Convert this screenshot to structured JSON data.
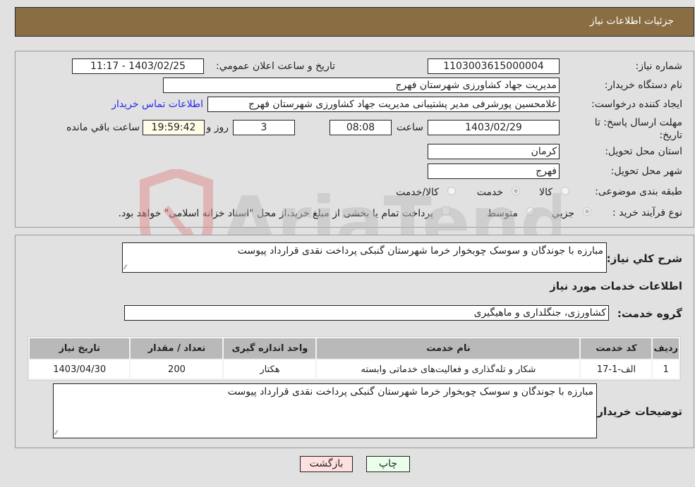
{
  "header": {
    "title": "جزئیات اطلاعات نیاز"
  },
  "details": {
    "need_number": {
      "label": "شماره نیاز:",
      "value": "1103003615000004"
    },
    "announce_datetime": {
      "label": "تاریخ و ساعت اعلان عمومي:",
      "value": "1403/02/25 - 11:17"
    },
    "buyer_org": {
      "label": "نام دستگاه خريدار:",
      "value": "مدیریت جهاد کشاورزی شهرستان فهرج"
    },
    "requester": {
      "label": "ایجاد کننده درخواست:",
      "value": "غلامحسین پورشرفی مدیر پشتیبانی مدیریت جهاد کشاورزی شهرستان فهرج"
    },
    "buyer_contact_link": "اطلاعات تماس خریدار",
    "deadline": {
      "label": "مهلت ارسال پاسخ: تا تاریخ:",
      "date": "1403/02/29",
      "time_label": "ساعت",
      "time": "08:08",
      "days": "3",
      "days_label": "روز و",
      "remaining": "19:59:42",
      "remaining_label": "ساعت باقي مانده"
    },
    "province": {
      "label": "استان محل تحویل:",
      "value": "کرمان"
    },
    "city": {
      "label": "شهر محل تحویل:",
      "value": "فهرج"
    },
    "category": {
      "label": "طبقه بندی موضوعی:",
      "options": [
        {
          "label": "کالا",
          "selected": false
        },
        {
          "label": "خدمت",
          "selected": true
        },
        {
          "label": "کالا/خدمت",
          "selected": false
        }
      ]
    },
    "purchase_type": {
      "label": "نوع فرآیند خرید :",
      "options": [
        {
          "label": "جزيي",
          "selected": true
        },
        {
          "label": "متوسط",
          "selected": false
        }
      ],
      "treasury_checkbox": {
        "label": "پرداخت تمام یا بخشی از مبلغ خرید،از محل \"اسناد خزانه اسلامی\" خواهد بود.",
        "checked": false
      }
    }
  },
  "summary": {
    "label": "شرح كلي نياز:",
    "value": "مبارزه با جوندگان و سوسک چوبخوار خرما شهرستان گنبکی پرداخت نقدی قرارداد پیوست"
  },
  "services": {
    "section_title": "اطلاعات خدمات مورد نیاز",
    "group_label": "گروه خدمت:",
    "group_value": "کشاورزی، جنگلداری و ماهیگیری",
    "table": {
      "headers": [
        "ردیف",
        "کد خدمت",
        "نام خدمت",
        "واحد اندازه گیری",
        "تعداد / مقدار",
        "تاریخ نیاز"
      ],
      "rows": [
        [
          "1",
          "الف-1-17",
          "شکار و تله‌گذاری و فعالیت‌های خدماتی وابسته",
          "هکتار",
          "200",
          "1403/04/30"
        ]
      ]
    }
  },
  "buyer_notes": {
    "label": "توضیحات خریدار:",
    "value": "مبارزه با جوندگان و سوسک چوبخوار خرما شهرستان گنبکی پرداخت نقدی قرارداد پیوست"
  },
  "buttons": {
    "print": {
      "label": "چاپ",
      "color": "#eaffea"
    },
    "back": {
      "label": "بازگشت",
      "color": "#ffe0e0"
    }
  },
  "watermark": {
    "text": "AriaTender.neT"
  }
}
